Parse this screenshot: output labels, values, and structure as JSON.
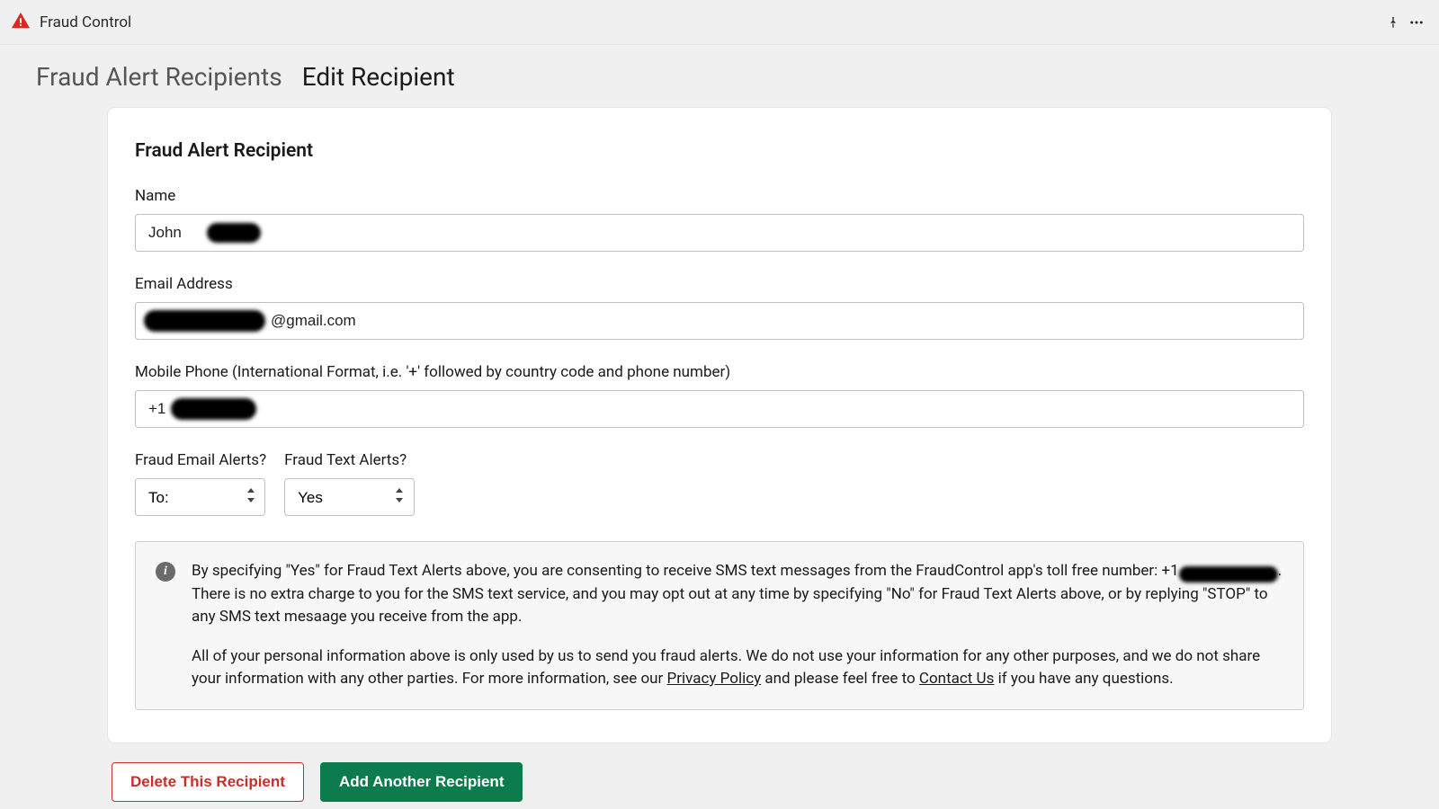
{
  "header": {
    "app_title": "Fraud Control"
  },
  "breadcrumb": {
    "prev": "Fraud Alert Recipients",
    "current": "Edit Recipient"
  },
  "card": {
    "title": "Fraud Alert Recipient",
    "fields": {
      "name_label": "Name",
      "name_value": "John ",
      "email_label": "Email Address",
      "email_value_suffix": "@gmail.com",
      "phone_label": "Mobile Phone (International Format, i.e. '+' followed by country code and phone number)",
      "phone_value_prefix": "+1"
    },
    "selects": {
      "email_alerts_label": "Fraud Email Alerts?",
      "email_alerts_value": "To:",
      "text_alerts_label": "Fraud Text Alerts?",
      "text_alerts_value": "Yes"
    },
    "info": {
      "p1_a": "By specifying \"Yes\" for Fraud Text Alerts above, you are consenting to receive SMS text messages from the FraudControl app's toll free number: +1",
      "p1_b": ". There is no extra charge to you for the SMS text service, and you may opt out at any time by specifying \"No\" for Fraud Text Alerts above, or by replying \"STOP\" to any SMS text mesaage you receive from the app.",
      "p2_a": "All of your personal information above is only used by us to send you fraud alerts. We do not use your information for any other purposes, and we do not share your information with any other parties. For more information, see our ",
      "privacy_link": "Privacy Policy",
      "p2_b": " and please feel free to ",
      "contact_link": "Contact Us",
      "p2_c": " if you have any questions."
    }
  },
  "buttons": {
    "delete": "Delete This Recipient",
    "add": "Add Another Recipient"
  }
}
